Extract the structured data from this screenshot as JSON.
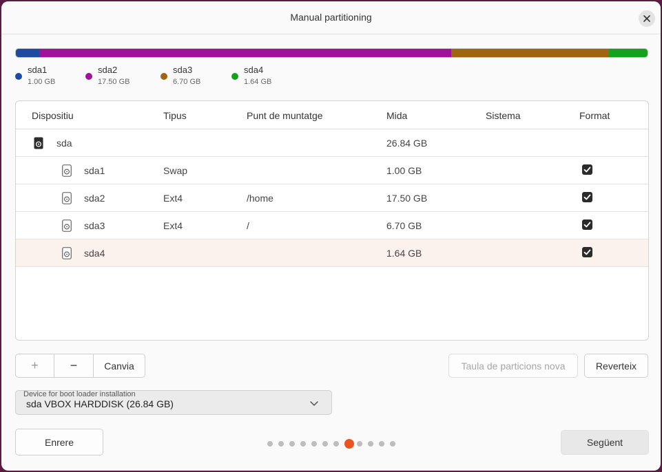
{
  "window": {
    "title": "Manual partitioning"
  },
  "colors": {
    "sda1": "#1e4aa2",
    "sda2": "#a0129a",
    "sda3": "#a0650f",
    "sda4": "#14a21e",
    "accent": "#e95420"
  },
  "usage": [
    {
      "name": "sda1",
      "size": "1.00 GB",
      "value": 1.0
    },
    {
      "name": "sda2",
      "size": "17.50 GB",
      "value": 17.5
    },
    {
      "name": "sda3",
      "size": "6.70 GB",
      "value": 6.7
    },
    {
      "name": "sda4",
      "size": "1.64 GB",
      "value": 1.64
    }
  ],
  "table": {
    "headers": {
      "device": "Dispositiu",
      "type": "Tipus",
      "mount": "Punt de muntatge",
      "size": "Mida",
      "system": "Sistema",
      "format": "Format"
    },
    "rows": [
      {
        "device": "sda",
        "type": "",
        "mount": "",
        "size": "26.84 GB",
        "format": null
      },
      {
        "device": "sda1",
        "type": "Swap",
        "mount": "",
        "size": "1.00 GB",
        "format": true
      },
      {
        "device": "sda2",
        "type": "Ext4",
        "mount": "/home",
        "size": "17.50 GB",
        "format": true
      },
      {
        "device": "sda3",
        "type": "Ext4",
        "mount": "/",
        "size": "6.70 GB",
        "format": true
      },
      {
        "device": "sda4",
        "type": "",
        "mount": "",
        "size": "1.64 GB",
        "format": true
      }
    ]
  },
  "actions": {
    "add": "+",
    "remove": "−",
    "change": "Canvia",
    "new_table": "Taula de particions nova",
    "revert": "Reverteix"
  },
  "bootloader": {
    "label": "Device for boot loader installation",
    "value": "sda VBOX HARDDISK (26.84 GB)"
  },
  "footer": {
    "back": "Enrere",
    "next": "Següent",
    "steps_total": 12,
    "current_step": 8
  }
}
